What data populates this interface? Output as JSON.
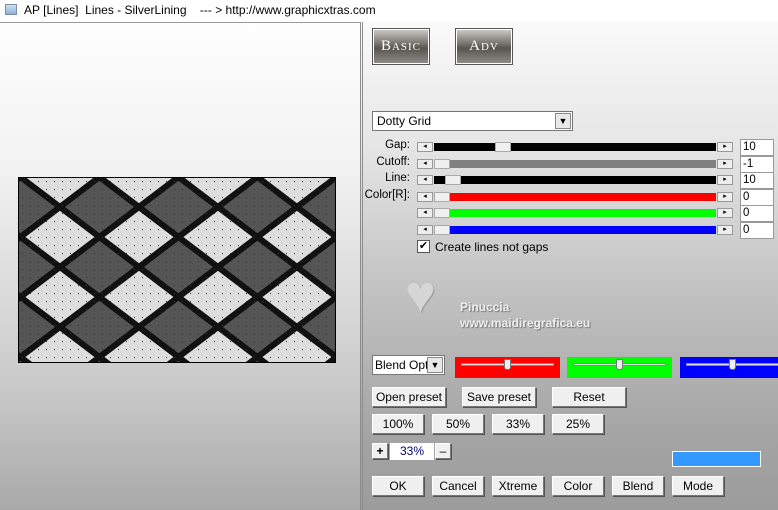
{
  "window": {
    "title": "AP [Lines]  Lines - SilverLining    --- > http://www.graphicxtras.com"
  },
  "tabs": {
    "basic": "Basic",
    "adv": "Adv"
  },
  "preset_combo": {
    "value": "Dotty Grid"
  },
  "sliders": [
    {
      "label": "Gap:",
      "value": "10",
      "color": "#000000",
      "position": 0.23
    },
    {
      "label": "Cutoff:",
      "value": "-1",
      "color": "#808080",
      "position": 0.0
    },
    {
      "label": "Line:",
      "value": "10",
      "color": "#000000",
      "position": 0.04
    },
    {
      "label": "Color[R]:",
      "value": "0",
      "color": "#ff0000",
      "position": 0.0
    },
    {
      "label": "",
      "value": "0",
      "color": "#00ff00",
      "position": 0.0
    },
    {
      "label": "",
      "value": "0",
      "color": "#0000ff",
      "position": 0.0
    }
  ],
  "checkbox": {
    "label": "Create lines not gaps",
    "checked": true
  },
  "watermark": {
    "name": "Pinuccia",
    "url": "www.maidiregrafica.eu"
  },
  "blend_combo": {
    "value": "Blend Opti"
  },
  "color_sliders": [
    {
      "color": "#ff0000",
      "position": 0.5
    },
    {
      "color": "#00ff00",
      "position": 0.5
    },
    {
      "color": "#0000ff",
      "position": 0.5
    }
  ],
  "buttons": {
    "open_preset": "Open preset",
    "save_preset": "Save preset",
    "reset": "Reset",
    "z100": "100%",
    "z50": "50%",
    "z33": "33%",
    "z25": "25%",
    "plus": "+",
    "minus": "–",
    "zoom_value": "33%",
    "ok": "OK",
    "cancel": "Cancel",
    "xtreme": "Xtreme",
    "color": "Color",
    "blend": "Blend",
    "mode": "Mode"
  },
  "color_swatch": "#3399ff"
}
